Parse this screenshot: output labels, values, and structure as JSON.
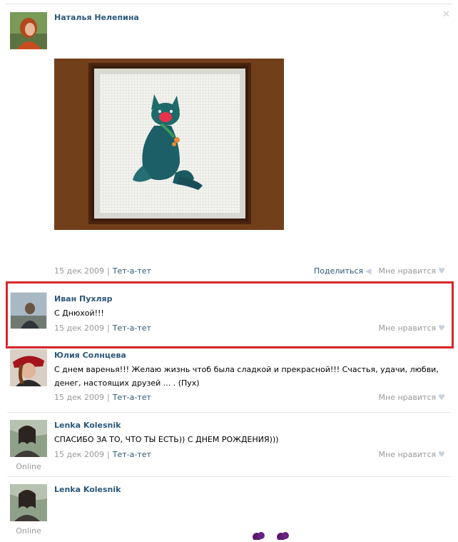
{
  "posts": [
    {
      "author": "Наталья Нелепина",
      "date": "15 дек 2009",
      "link": "Тет-а-тет",
      "share": "Поделиться",
      "like": "Мне нравится"
    },
    {
      "author": "Иван Пухляр",
      "text": "С Днюхой!!!",
      "date": "15 дек 2009",
      "link": "Тет-а-тет",
      "like": "Мне нравится"
    },
    {
      "author": "Юлия Солнцева",
      "text": "С днем варенья!!! Желаю жизнь чтоб была сладкой и прекрасной!!! Счастья, удачи, любви, денег, настоящих друзей ... . (Пух)",
      "date": "15 дек 2009",
      "link": "Тет-а-тет",
      "like": "Мне нравится"
    },
    {
      "author": "Lenka Kolesnik",
      "text": "СПАСИБО ЗА ТО, ЧТО ТЫ ЕСТЬ)) С ДНЕМ РОЖДЕНИЯ)))",
      "date": "15 дек 2009",
      "link": "Тет-а-тет",
      "like": "Мне нравится",
      "status": "Online"
    },
    {
      "author": "Lenka Kolesnik",
      "status": "Online"
    }
  ],
  "icons": {
    "close": "close-icon",
    "heart": "heart-icon",
    "share": "megaphone-icon"
  },
  "colors": {
    "link": "#2b587a",
    "muted": "#999999",
    "highlight": "#d7252a"
  }
}
